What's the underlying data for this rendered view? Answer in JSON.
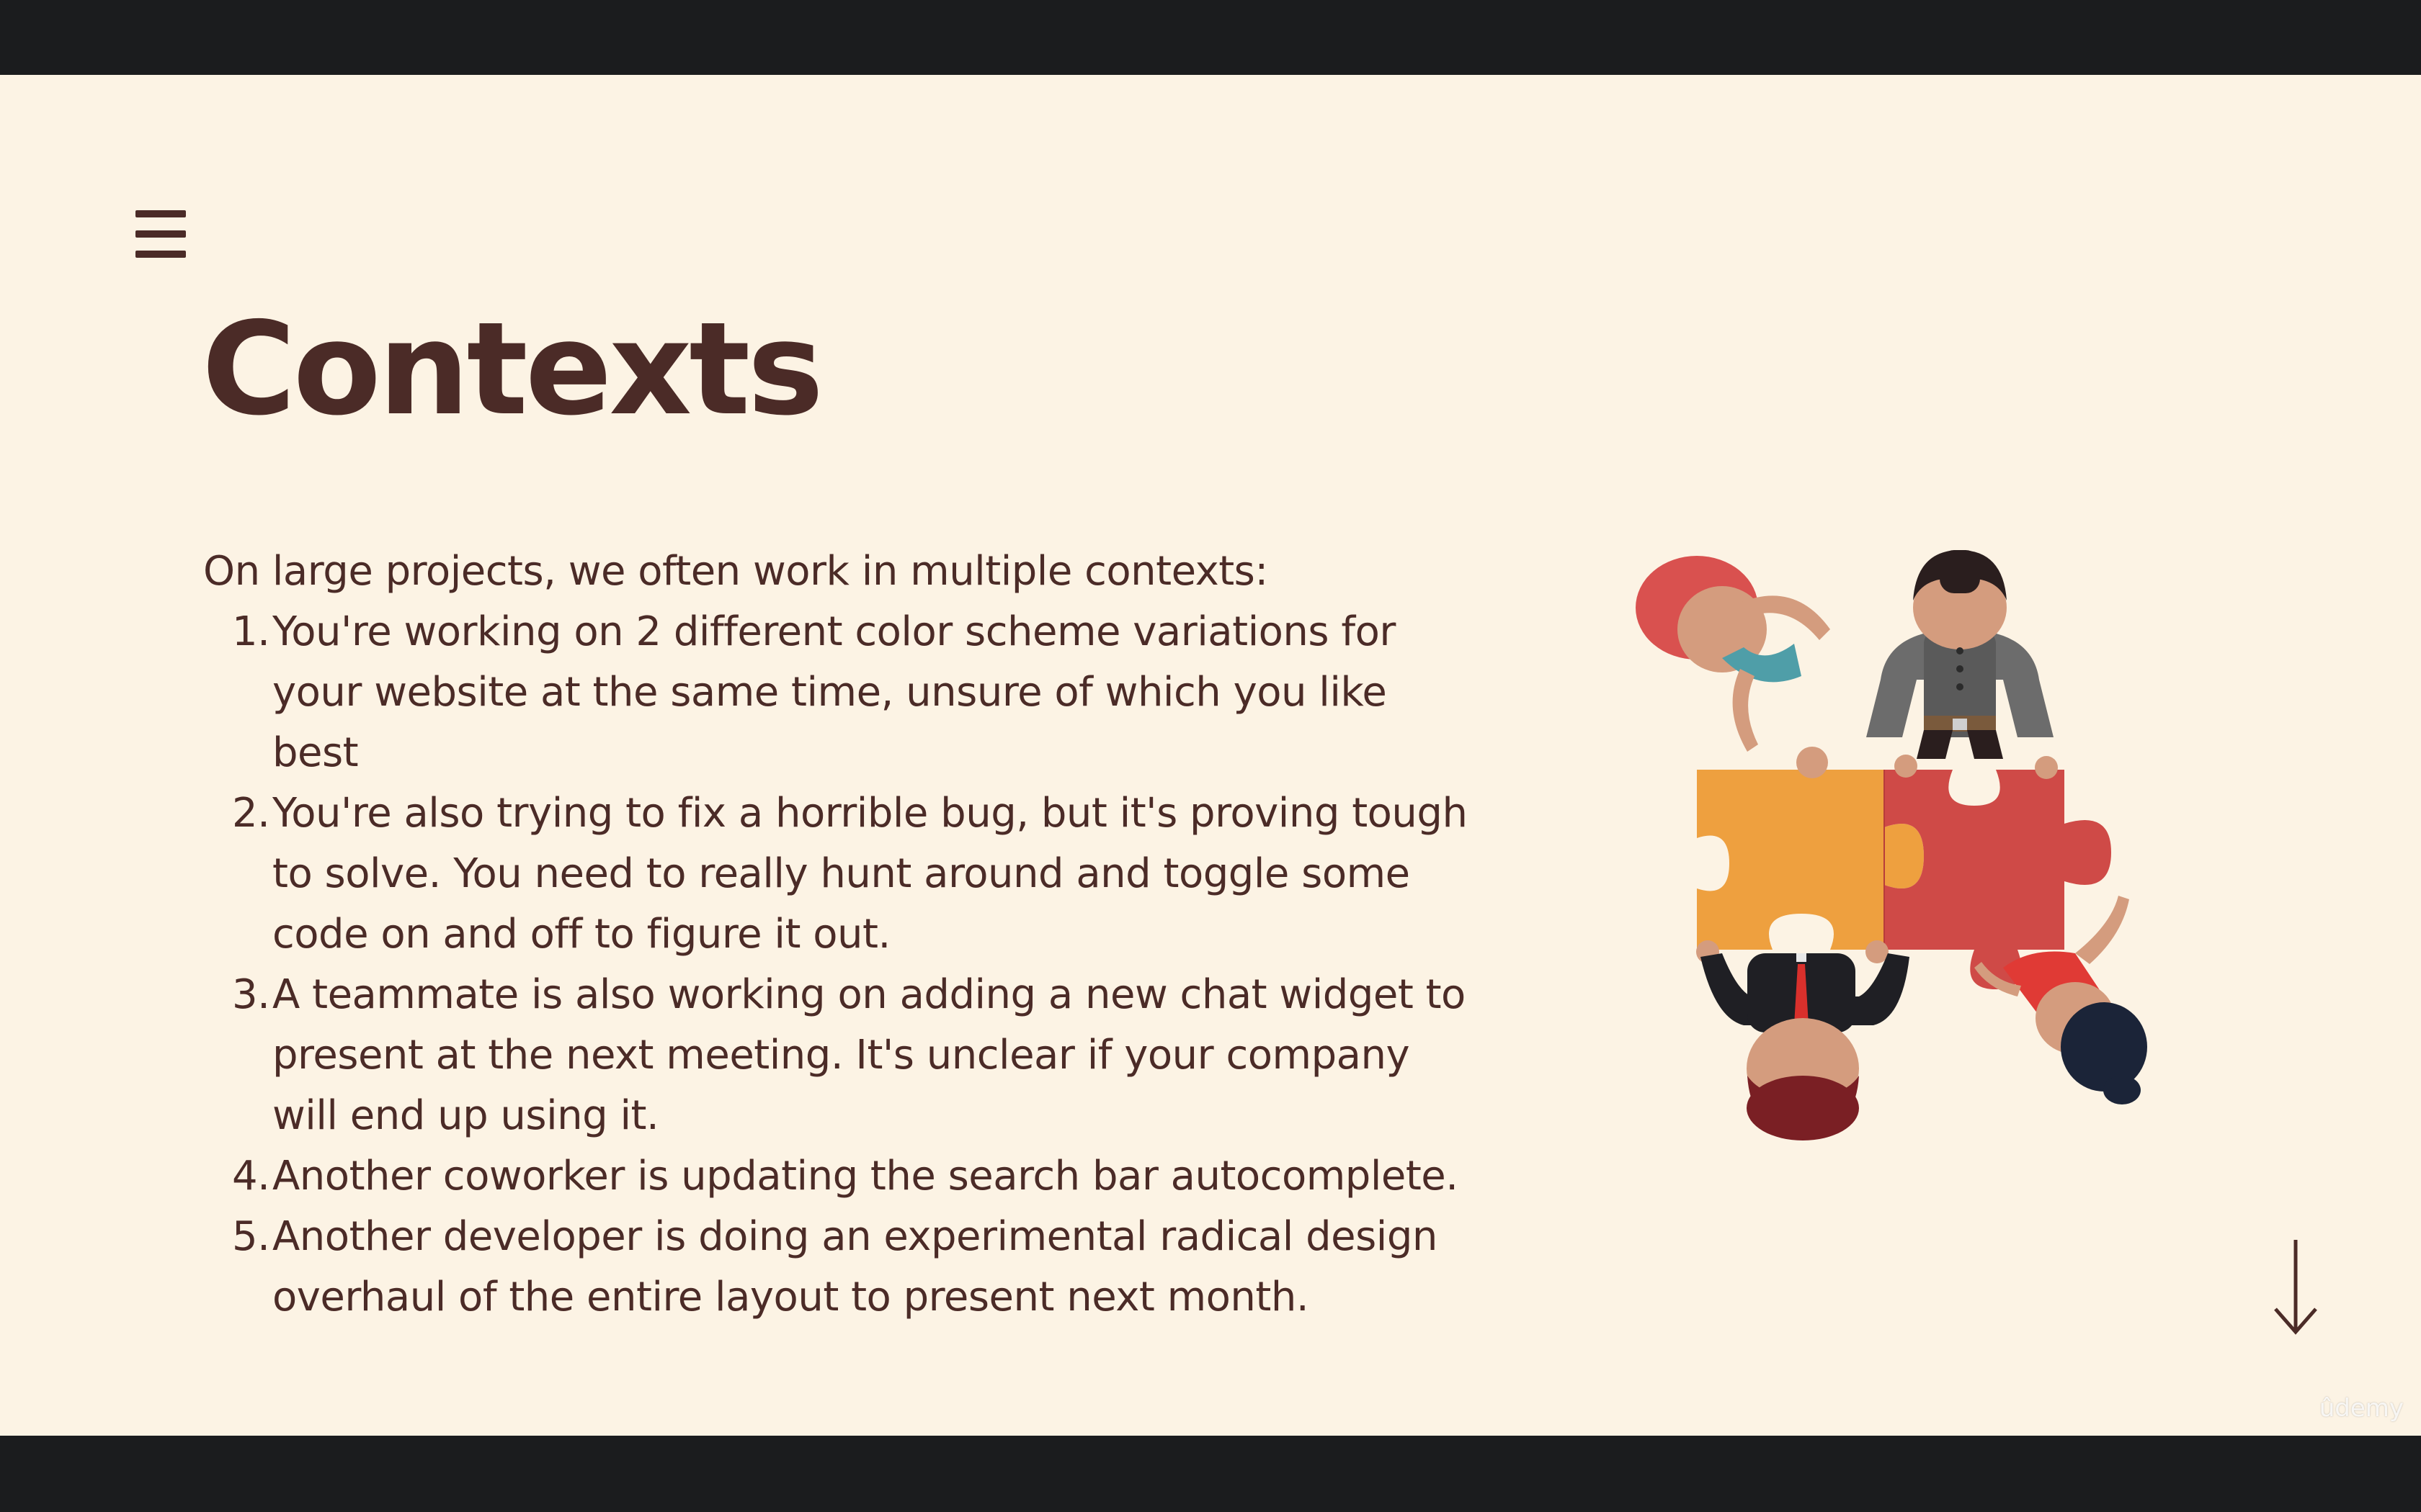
{
  "slide": {
    "title": "Contexts",
    "intro": "On large projects, we often work in multiple contexts:",
    "items": [
      {
        "num": "1.",
        "text": "You're working on 2 different color scheme variations for your website at the same time, unsure of which you like best"
      },
      {
        "num": "2.",
        "text": "You're also trying to fix a horrible bug, but it's proving tough to solve.  You need to really hunt around and toggle some code on and off to figure it out."
      },
      {
        "num": "3.",
        "text": "A teammate is also working on adding a new chat widget to present at the next meeting.  It's unclear if your company will end up using it."
      },
      {
        "num": "4.",
        "text": "Another coworker is updating the search bar autocomplete."
      },
      {
        "num": "5.",
        "text": "Another developer is doing an experimental radical design overhaul of the entire layout to present next month."
      }
    ]
  },
  "icons": {
    "menu": "hamburger-menu-icon",
    "next": "arrow-down-icon",
    "illustration": "teamwork-puzzle-illustration"
  },
  "watermark": "ûdemy",
  "colors": {
    "background": "#fcf3e4",
    "text": "#4b2b27",
    "letterbox": "#1b1c1e",
    "puzzle_orange": "#eea03f",
    "puzzle_red": "#cf4a47"
  }
}
